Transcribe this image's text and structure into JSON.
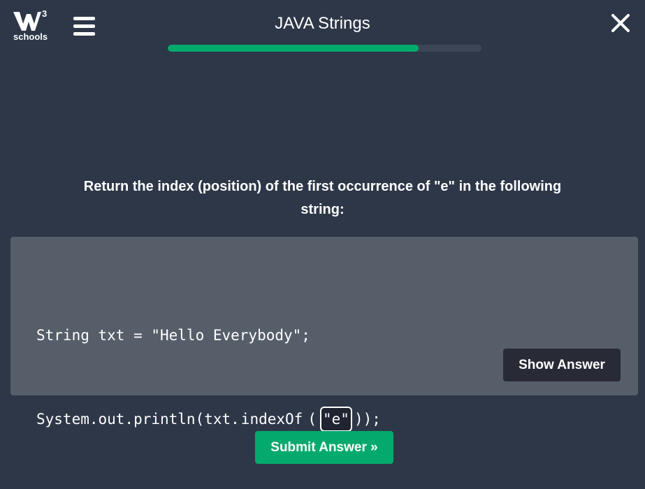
{
  "header": {
    "logo": {
      "superscript": "3",
      "wordmark": "schools",
      "icon": "w3schools-logo"
    },
    "menu_icon": "hamburger-menu-icon",
    "title": "JAVA Strings",
    "progress_percent": 80,
    "close_icon": "close-icon"
  },
  "question": {
    "part1": "Return the ",
    "bold_word": "index",
    "part2": " (position) of the first occurrence of ",
    "quoted_char": "\"e\"",
    "part3": " in the following string:"
  },
  "code": {
    "line1": "String txt = \"Hello Everybody\";",
    "line2_prefix": "System.out.println(txt.",
    "line2_method": "indexOf",
    "line2_open": "(",
    "answer_value": "\"e\"",
    "line2_suffix": "));"
  },
  "buttons": {
    "show_answer": "Show Answer",
    "submit": "Submit Answer »"
  },
  "colors": {
    "background": "#2d3748",
    "panel": "#565e6a",
    "accent_green": "#04aa6d",
    "dark_button": "#282a35"
  }
}
